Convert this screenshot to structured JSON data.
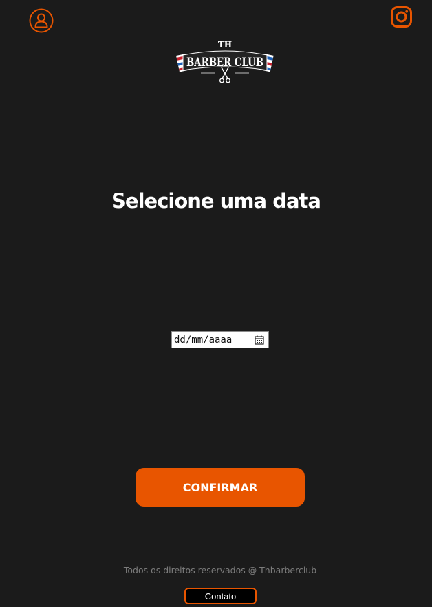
{
  "header": {
    "profile_icon": "user-circle-icon",
    "instagram_icon": "instagram-icon"
  },
  "logo": {
    "top_text": "TH",
    "brand_text": "BARBER CLUB"
  },
  "main": {
    "title": "Selecione uma data",
    "date_input": {
      "placeholder": "dd/mm/aaaa",
      "icon": "calendar-icon"
    },
    "confirm_label": "CONFIRMAR"
  },
  "footer": {
    "copyright": "Todos os direitos reservados @ Thbarberclub",
    "contact_label": "Contato"
  },
  "colors": {
    "background": "#1b1b1b",
    "accent": "#e85500",
    "text": "#ffffff",
    "muted": "#7c7c7c"
  }
}
